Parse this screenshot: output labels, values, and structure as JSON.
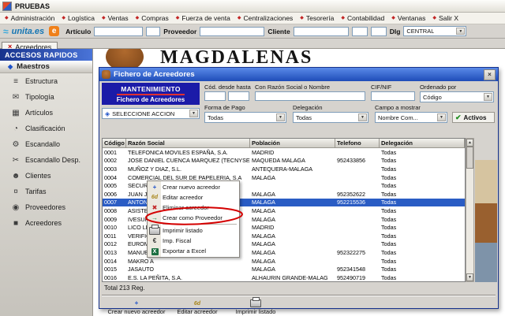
{
  "app": {
    "title": "PRUEBAS",
    "menu": [
      "Administración",
      "Logística",
      "Ventas",
      "Compras",
      "Fuerza de venta",
      "Centralizaciones",
      "Tesorería",
      "Contabilidad",
      "Ventanas",
      "Salir X"
    ],
    "toolbar": {
      "logo_text": "unita.es",
      "article_label": "Artículo",
      "provider_label": "Proveedor",
      "client_label": "Cliente",
      "dlg_label": "Dlg",
      "dlg_value": "CENTRAL"
    },
    "tab": "Acreedores"
  },
  "sidebar": {
    "header": "ACCESOS RAPIDOS",
    "section": "Maestros",
    "items": [
      {
        "label": "Estructura",
        "icon": "≡"
      },
      {
        "label": "Tipología",
        "icon": "✉"
      },
      {
        "label": "Artículos",
        "icon": "▦"
      },
      {
        "label": "Clasificación",
        "icon": "◔"
      },
      {
        "label": "Escandallo",
        "icon": "⚙"
      },
      {
        "label": "Escandallo Desp.",
        "icon": "✂"
      },
      {
        "label": "Clientes",
        "icon": "☻"
      },
      {
        "label": "Tarifas",
        "icon": "¤"
      },
      {
        "label": "Proveedores",
        "icon": "◉"
      },
      {
        "label": "Acreedores",
        "icon": "■"
      }
    ]
  },
  "background": {
    "watermark": "MAGDALENAS"
  },
  "dialog": {
    "title": "Fichero de Acreedores",
    "banner_line1": "MANTENIMIENTO",
    "banner_line2": "Fichero de Acreedores",
    "filters": {
      "cod_label": "Cód. desde hasta",
      "razon_label": "Con Razón Social o Nombre",
      "cif_label": "CIF/NIF",
      "ordenado_label": "Ordenado por",
      "ordenado_value": "Código",
      "accion_value": "SELECCIONE ACCION",
      "forma_pago_label": "Forma de Pago",
      "forma_pago_value": "Todas",
      "delegacion_label": "Delegación",
      "delegacion_value": "Todas",
      "campo_label": "Campo a mostrar",
      "campo_value": "Nombre Com...",
      "activos_label": "Activos"
    },
    "table": {
      "headers": [
        "Código",
        "Razón Social",
        "Población",
        "Telefono",
        "Delegación"
      ],
      "selected_index": 6,
      "rows": [
        [
          "0001",
          "TELEFONICA MOVILES ESPAÑA, S.A.",
          "MADRID",
          "",
          "Todas"
        ],
        [
          "0002",
          "JOSE DANIEL CUENCA MARQUEZ (TECNYSERVI)",
          "MAQUEDA    MALAGA",
          "952433856",
          "Todas"
        ],
        [
          "0003",
          "MUÑOZ Y DIAZ, S.L.",
          "ANTEQUERA-MALAGA",
          "",
          "Todas"
        ],
        [
          "0004",
          "COMERCIAL DEL SUR DE PAPELERIA, S.A",
          "MALAGA",
          "",
          "Todas"
        ],
        [
          "0005",
          "SECURITAS DIRECT ESPAÑA, S.A.U.",
          "",
          "",
          "Todas"
        ],
        [
          "0006",
          "JUAN J. MENGIBAR, SL.",
          "MALAGA",
          "952352622",
          "Todas"
        ],
        [
          "0007",
          "ANTONIA ROSAS DIAZ",
          "MALAGA",
          "952215536",
          "Todas"
        ],
        [
          "0008",
          "ASISTENC",
          "MALAGA",
          "",
          "Todas"
        ],
        [
          "0009",
          "IVESUR, S",
          "MALAGA",
          "",
          "Todas"
        ],
        [
          "0010",
          "LICO LEAS",
          "MADRID",
          "",
          "Todas"
        ],
        [
          "0011",
          "VERIFICA",
          "MALAGA",
          "",
          "Todas"
        ],
        [
          "0012",
          "EUROMUT",
          "MALAGA",
          "",
          "Todas"
        ],
        [
          "0013",
          "MANUEL J",
          "MALAGA",
          "952322275",
          "Todas"
        ],
        [
          "0014",
          "MAKRO A",
          "MALAGA",
          "",
          "Todas"
        ],
        [
          "0015",
          "JASAUTO",
          "MALAGA",
          "952341548",
          "Todas"
        ],
        [
          "0016",
          "E.S. LA PEÑITA, S.A.",
          "ALHAURIN GRANDE-MALAG",
          "952490719",
          "Todas"
        ]
      ]
    },
    "footer": {
      "total": "Total 213 Reg.",
      "buttons": [
        {
          "label": "Crear nuevo acreedor",
          "icon": "plus"
        },
        {
          "label": "Editar acreedor",
          "icon": "edit"
        },
        {
          "label": "Imprimir listado",
          "icon": "printer"
        }
      ]
    }
  },
  "context_menu": {
    "items": [
      {
        "label": "Crear nuevo acreedor",
        "icon": "plus"
      },
      {
        "label": "Editar acreedor",
        "icon": "edit"
      },
      {
        "label": "Eliminar acreedor",
        "icon": "delete"
      },
      {
        "label": "Crear como Proveedor",
        "icon": "convert",
        "annotated": true
      },
      {
        "separator": true
      },
      {
        "label": "Imprimir listado",
        "icon": "printer"
      },
      {
        "label": "Imp. Fiscal",
        "icon": "fiscal"
      },
      {
        "label": "Exportar a Excel",
        "icon": "excel"
      }
    ]
  },
  "colors": {
    "titlebar_blue": "#1e4cb8",
    "banner_blue": "#1b1ba8",
    "selection_blue": "#2a5cc4",
    "sidebar_header_blue": "#16328c",
    "annotation_red": "#d40000",
    "accent_orange": "#f08019"
  }
}
